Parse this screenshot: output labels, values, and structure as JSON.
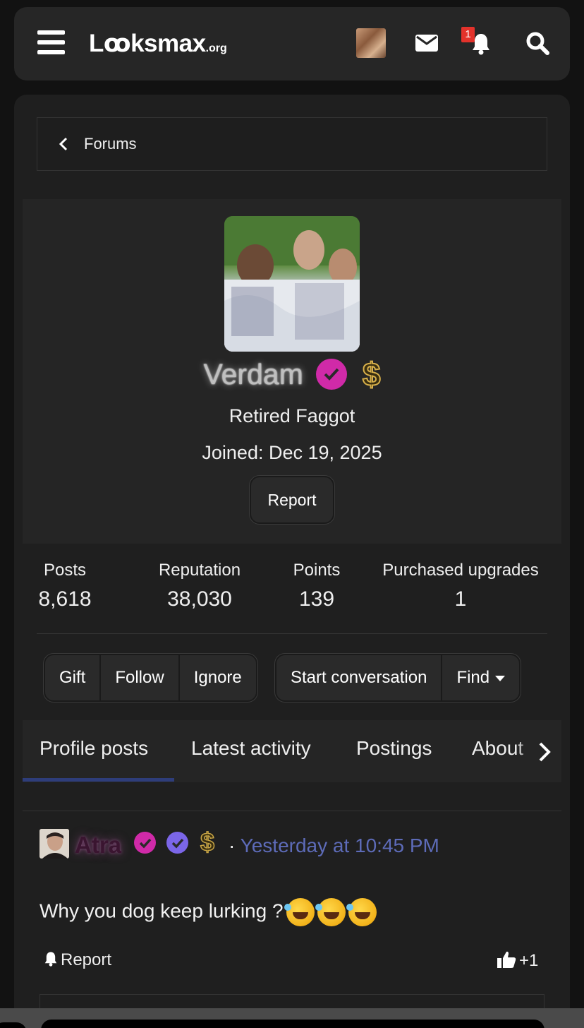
{
  "header": {
    "logo_main": "Lꝏksmax",
    "logo_suffix": ".org",
    "notification_count": "1"
  },
  "breadcrumb": {
    "label": "Forums"
  },
  "profile": {
    "username": "Verdam",
    "dollar_symbol": "$",
    "user_title": "Retired Faggot",
    "joined": "Joined: Dec 19, 2025",
    "report_label": "Report"
  },
  "stats": [
    {
      "label": "Posts",
      "value": "8,618"
    },
    {
      "label": "Reputation",
      "value": "38,030"
    },
    {
      "label": "Points",
      "value": "139"
    },
    {
      "label": "Purchased upgrades",
      "value": "1"
    }
  ],
  "actions": {
    "gift": "Gift",
    "follow": "Follow",
    "ignore": "Ignore",
    "start_conversation": "Start conversation",
    "find": "Find"
  },
  "tabs": [
    {
      "label": "Profile posts",
      "active": true
    },
    {
      "label": "Latest activity"
    },
    {
      "label": "Postings"
    },
    {
      "label": "About"
    }
  ],
  "post": {
    "author": "Atra",
    "dollar_symbol": "$",
    "separator": "·",
    "time": "Yesterday at 10:45 PM",
    "text": "Why you dog keep lurking ?",
    "emoji_count": 3,
    "emoji_name": "rolling-on-floor-laughing",
    "report_label": "Report",
    "reaction_score": "+1"
  },
  "colors": {
    "background": "#121212",
    "card": "#1f1f1f",
    "panel": "#252525",
    "accent_badge": "#d02aa8",
    "verified_badge": "#7b66e8",
    "link_time": "#5d6bb8",
    "tab_underline": "#2e3d7a",
    "notification_badge": "#e3322b"
  }
}
